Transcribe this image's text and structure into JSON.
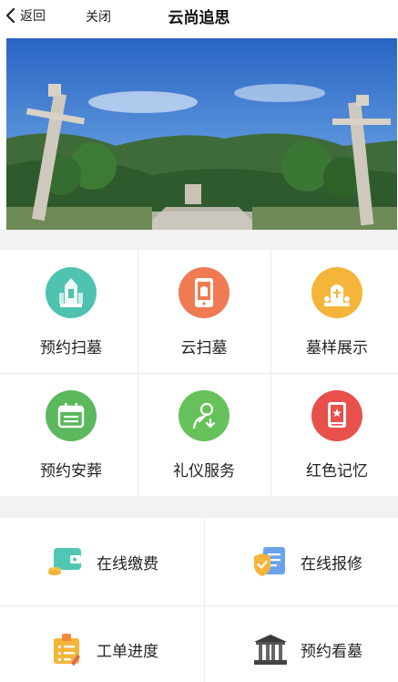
{
  "nav": {
    "back_label": "返回",
    "close_label": "关闭",
    "title": "云尚追思"
  },
  "grid": [
    {
      "label": "预约扫墓",
      "icon": "memorial-tower-icon",
      "color": "#4fc3b0"
    },
    {
      "label": "云扫墓",
      "icon": "phone-memorial-icon",
      "color": "#f07a52"
    },
    {
      "label": "墓样展示",
      "icon": "tombstone-icon",
      "color": "#f5b43a"
    },
    {
      "label": "预约安葬",
      "icon": "calendar-icon",
      "color": "#5cb85c"
    },
    {
      "label": "礼仪服务",
      "icon": "people-service-icon",
      "color": "#66c15a"
    },
    {
      "label": "红色记忆",
      "icon": "red-book-icon",
      "color": "#e8504c"
    }
  ],
  "services": [
    {
      "label": "在线缴费",
      "icon": "wallet-icon"
    },
    {
      "label": "在线报修",
      "icon": "repair-report-icon"
    },
    {
      "label": "工单进度",
      "icon": "work-order-icon"
    },
    {
      "label": "预约看墓",
      "icon": "memorial-gate-icon"
    }
  ]
}
